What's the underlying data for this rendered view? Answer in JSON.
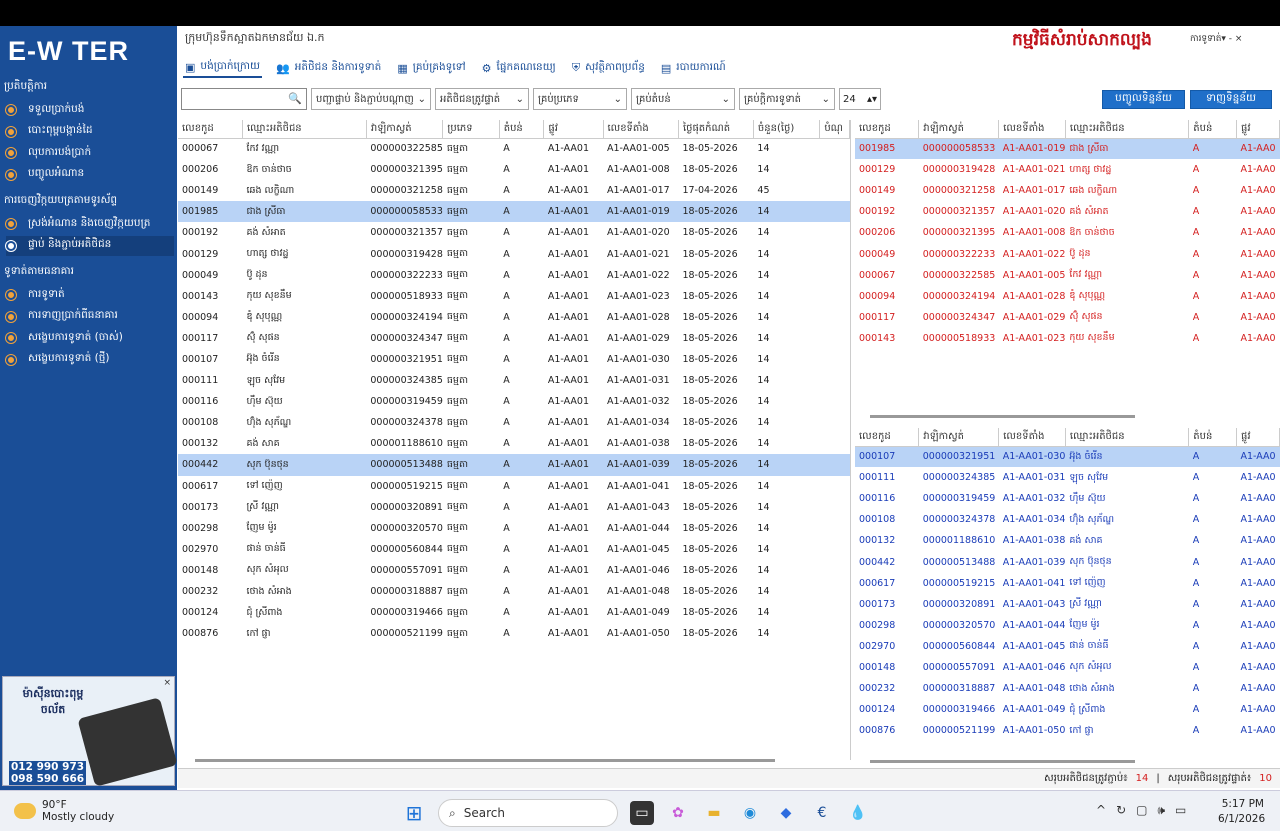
{
  "sidebar": {
    "logo": "E-W TER",
    "sections": [
      {
        "title": "ប្រតិបត្តិការ",
        "items": [
          "ទទួលប្រាក់បង់",
          "បោះពុម្ពបង្កាន់ដៃ",
          "លុបការបង់ប្រាក់",
          "បញ្ចូលអំណាន"
        ]
      },
      {
        "title": "ការចេញវិក្កយបត្រតាមទូរស័ព្ទ",
        "items": [
          "ស្រង់អំណាន និងចេញវិក្កយបត្រ",
          "ផ្ទាប់ និងភ្ជាប់អតិថិជន"
        ]
      },
      {
        "title": "ទូទាត់តាមធនាគារ",
        "items": [
          "ការទូទាត់",
          "ការទាញប្រាក់ពីធនាគារ",
          "សង្ខេបការទូទាត់ (ចាស់)",
          "សង្ខេបការទូទាត់ (ថ្មី)"
        ]
      }
    ],
    "ad": {
      "title": "ម៉ាស៊ីនបោះពុម្ពចល័ត",
      "phone1": "012 990 973",
      "phone2": "098 590 666",
      "close": "×"
    }
  },
  "header": {
    "company": "ក្រុមហ៊ុនទឹកស្អាតឯកមានជ័យ ឯ.ក",
    "title": "កម្មវិធីសំរាប់សាកល្បង",
    "user": "ការទូទាត់▾ - ×"
  },
  "tabs": [
    "បង់ប្រាក់ក្រោយ",
    "អតិថិជន និងការទូទាត់",
    "គ្រប់គ្រងទូទៅ",
    "ផ្នែកគណនេយ្យ",
    "សុវត្ថិភាពប្រព័ន្ធ",
    "របាយការណ៍"
  ],
  "tab_icons": [
    "book-icon",
    "users-icon",
    "grid-icon",
    "gear-icon",
    "shield-icon",
    "report-icon"
  ],
  "toolbar": {
    "search_value": "",
    "dropdowns": [
      "បញ្ជាផ្ទាប់ និងភ្ជាប់បណ្តាញ",
      "អតិថិជនត្រូវផ្ទាត់",
      "គ្រប់ប្រភេទ",
      "គ្រប់តំបន់",
      "គ្រប់ក្តិការទូទាត់"
    ],
    "number": "24",
    "btn1": "បញ្ចូលទិន្នន័យ",
    "btn2": "ទាញទិន្នន័យ"
  },
  "left_table": {
    "headers": [
      "លេខកូដ",
      "ឈ្មោះអតិថិជន",
      "វាឡិកាស្វត់",
      "ប្រភេទ",
      "តំបន់",
      "ផ្លូវ",
      "លេខទីតាំង",
      "ថ្ងៃផុតកំណត់",
      "ចំនួន(ថ្ងៃ)",
      "បំណុ"
    ],
    "rows": [
      [
        "000067",
        "កែវ វណ្ណា",
        "000000322585",
        "ធម្មតា",
        "A",
        "A1-AA01",
        "A1-AA01-005",
        "18-05-2026",
        "14",
        ""
      ],
      [
        "000206",
        "ឱក ចាន់ថាច",
        "000000321395",
        "ធម្មតា",
        "A",
        "A1-AA01",
        "A1-AA01-008",
        "18-05-2026",
        "14",
        ""
      ],
      [
        "000149",
        "ឆេង លក្ខិណា",
        "000000321258",
        "ធម្មតា",
        "A",
        "A1-AA01",
        "A1-AA01-017",
        "17-04-2026",
        "45",
        ""
      ],
      [
        "001985",
        "ជាង ស្រីធា",
        "000000058533",
        "ធម្មតា",
        "A",
        "A1-AA01",
        "A1-AA01-019",
        "18-05-2026",
        "14",
        ""
      ],
      [
        "000192",
        "គង់ សំអាត",
        "000000321357",
        "ធម្មតា",
        "A",
        "A1-AA01",
        "A1-AA01-020",
        "18-05-2026",
        "14",
        ""
      ],
      [
        "000129",
        "ហាត្ស ថាវដ្ឋ",
        "000000319428",
        "ធម្មតា",
        "A",
        "A1-AA01",
        "A1-AA01-021",
        "18-05-2026",
        "14",
        ""
      ],
      [
        "000049",
        "ប៊ូ ដុន",
        "000000322233",
        "ធម្មតា",
        "A",
        "A1-AA01",
        "A1-AA01-022",
        "18-05-2026",
        "14",
        ""
      ],
      [
        "000143",
        "កុយ សុខនឹម",
        "000000518933",
        "ធម្មតា",
        "A",
        "A1-AA01",
        "A1-AA01-023",
        "18-05-2026",
        "14",
        ""
      ],
      [
        "000094",
        "ឌុំ សុបុណ្ណ",
        "000000324194",
        "ធម្មតា",
        "A",
        "A1-AA01",
        "A1-AA01-028",
        "18-05-2026",
        "14",
        ""
      ],
      [
        "000117",
        "ស៊ុំ សុផន",
        "000000324347",
        "ធម្មតា",
        "A",
        "A1-AA01",
        "A1-AA01-029",
        "18-05-2026",
        "14",
        ""
      ],
      [
        "000107",
        "អ៊ុង ចំរើន",
        "000000321951",
        "ធម្មតា",
        "A",
        "A1-AA01",
        "A1-AA01-030",
        "18-05-2026",
        "14",
        ""
      ],
      [
        "000111",
        "ឡុច សុវែម",
        "000000324385",
        "ធម្មតា",
        "A",
        "A1-AA01",
        "A1-AA01-031",
        "18-05-2026",
        "14",
        ""
      ],
      [
        "000116",
        "ហ៊ឹម ស៊ុយ",
        "000000319459",
        "ធម្មតា",
        "A",
        "A1-AA01",
        "A1-AA01-032",
        "18-05-2026",
        "14",
        ""
      ],
      [
        "000108",
        "ហ៊ុំង សុភ័ណ្ឌ",
        "000000324378",
        "ធម្មតា",
        "A",
        "A1-AA01",
        "A1-AA01-034",
        "18-05-2026",
        "14",
        ""
      ],
      [
        "000132",
        "គង់ សាគ",
        "000001188610",
        "ធម្មតា",
        "A",
        "A1-AA01",
        "A1-AA01-038",
        "18-05-2026",
        "14",
        ""
      ],
      [
        "000442",
        "សុក ប៊ុនថុន",
        "000000513488",
        "ធម្មតា",
        "A",
        "A1-AA01",
        "A1-AA01-039",
        "18-05-2026",
        "14",
        ""
      ],
      [
        "000617",
        "ទៅ ញ៉េញ",
        "000000519215",
        "ធម្មតា",
        "A",
        "A1-AA01",
        "A1-AA01-041",
        "18-05-2026",
        "14",
        ""
      ],
      [
        "000173",
        "ស្រី វណ្ណា",
        "000000320891",
        "ធម្មតា",
        "A",
        "A1-AA01",
        "A1-AA01-043",
        "18-05-2026",
        "14",
        ""
      ],
      [
        "000298",
        "ញែម ម៉ូរ",
        "000000320570",
        "ធម្មតា",
        "A",
        "A1-AA01",
        "A1-AA01-044",
        "18-05-2026",
        "14",
        ""
      ],
      [
        "002970",
        "ផាន់ ចាន់ធី",
        "000000560844",
        "ធម្មតា",
        "A",
        "A1-AA01",
        "A1-AA01-045",
        "18-05-2026",
        "14",
        ""
      ],
      [
        "000148",
        "សុក សំអុល",
        "000000557091",
        "ធម្មតា",
        "A",
        "A1-AA01",
        "A1-AA01-046",
        "18-05-2026",
        "14",
        ""
      ],
      [
        "000232",
        "ថោង សំអាង",
        "000000318887",
        "ធម្មតា",
        "A",
        "A1-AA01",
        "A1-AA01-048",
        "18-05-2026",
        "14",
        ""
      ],
      [
        "000124",
        "ជុំ ស្រីពាង",
        "000000319466",
        "ធម្មតា",
        "A",
        "A1-AA01",
        "A1-AA01-049",
        "18-05-2026",
        "14",
        ""
      ],
      [
        "000876",
        "កៅ ផ្ញា",
        "000000521199",
        "ធម្មតា",
        "A",
        "A1-AA01",
        "A1-AA01-050",
        "18-05-2026",
        "14",
        ""
      ]
    ],
    "selected": [
      3,
      15
    ]
  },
  "right_top_table": {
    "headers": [
      "លេខកូដ",
      "វាឡិកាស្វត់",
      "លេខទីតាំង",
      "ឈ្មោះអតិថិជន",
      "តំបន់",
      "ផ្លូវ"
    ],
    "rows": [
      [
        "001985",
        "000000058533",
        "A1-AA01-019",
        "ជាង ស្រីធា",
        "A",
        "A1-AA0"
      ],
      [
        "000129",
        "000000319428",
        "A1-AA01-021",
        "ហាត្ស ថាវដ្ឋ",
        "A",
        "A1-AA0"
      ],
      [
        "000149",
        "000000321258",
        "A1-AA01-017",
        "ឆេង លក្ខិណា",
        "A",
        "A1-AA0"
      ],
      [
        "000192",
        "000000321357",
        "A1-AA01-020",
        "គង់ សំអាត",
        "A",
        "A1-AA0"
      ],
      [
        "000206",
        "000000321395",
        "A1-AA01-008",
        "ឱក ចាន់ថាច",
        "A",
        "A1-AA0"
      ],
      [
        "000049",
        "000000322233",
        "A1-AA01-022",
        "ប៊ូ ដុន",
        "A",
        "A1-AA0"
      ],
      [
        "000067",
        "000000322585",
        "A1-AA01-005",
        "កែវ វណ្ណា",
        "A",
        "A1-AA0"
      ],
      [
        "000094",
        "000000324194",
        "A1-AA01-028",
        "ឌុំ សុបុណ្ណ",
        "A",
        "A1-AA0"
      ],
      [
        "000117",
        "000000324347",
        "A1-AA01-029",
        "ស៊ុំ សុផន",
        "A",
        "A1-AA0"
      ],
      [
        "000143",
        "000000518933",
        "A1-AA01-023",
        "កុយ សុខនឹម",
        "A",
        "A1-AA0"
      ]
    ],
    "selected": [
      0
    ]
  },
  "right_bottom_table": {
    "headers": [
      "លេខកូដ",
      "វាឡិកាស្វត់",
      "លេខទីតាំង",
      "ឈ្មោះអតិថិជន",
      "តំបន់",
      "ផ្លូវ"
    ],
    "rows": [
      [
        "000107",
        "000000321951",
        "A1-AA01-030",
        "អ៊ុង ចំរើន",
        "A",
        "A1-AA0"
      ],
      [
        "000111",
        "000000324385",
        "A1-AA01-031",
        "ឡុច សុវែម",
        "A",
        "A1-AA0"
      ],
      [
        "000116",
        "000000319459",
        "A1-AA01-032",
        "ហ៊ឹម ស៊ុយ",
        "A",
        "A1-AA0"
      ],
      [
        "000108",
        "000000324378",
        "A1-AA01-034",
        "ហ៊ុំង សុភ័ណ្ឌ",
        "A",
        "A1-AA0"
      ],
      [
        "000132",
        "000001188610",
        "A1-AA01-038",
        "គង់ សាគ",
        "A",
        "A1-AA0"
      ],
      [
        "000442",
        "000000513488",
        "A1-AA01-039",
        "សុក ប៊ុនថុន",
        "A",
        "A1-AA0"
      ],
      [
        "000617",
        "000000519215",
        "A1-AA01-041",
        "ទៅ ញ៉េញ",
        "A",
        "A1-AA0"
      ],
      [
        "000173",
        "000000320891",
        "A1-AA01-043",
        "ស្រី វណ្ណា",
        "A",
        "A1-AA0"
      ],
      [
        "000298",
        "000000320570",
        "A1-AA01-044",
        "ញែម ម៉ូរ",
        "A",
        "A1-AA0"
      ],
      [
        "002970",
        "000000560844",
        "A1-AA01-045",
        "ផាន់ ចាន់ធី",
        "A",
        "A1-AA0"
      ],
      [
        "000148",
        "000000557091",
        "A1-AA01-046",
        "សុក សំអុល",
        "A",
        "A1-AA0"
      ],
      [
        "000232",
        "000000318887",
        "A1-AA01-048",
        "ថោង សំអាង",
        "A",
        "A1-AA0"
      ],
      [
        "000124",
        "000000319466",
        "A1-AA01-049",
        "ជុំ ស្រីពាង",
        "A",
        "A1-AA0"
      ],
      [
        "000876",
        "000000521199",
        "A1-AA01-050",
        "កៅ ផ្ញា",
        "A",
        "A1-AA0"
      ]
    ],
    "selected": [
      0
    ]
  },
  "status": {
    "label1": "សរុបអតិថិជនត្រូវភ្ជាប់៖",
    "value1": "14",
    "sep": "|",
    "label2": "សរុបអតិថិជនត្រូវផ្ទាត់៖",
    "value2": "10"
  },
  "taskbar": {
    "temp": "90°F",
    "weather": "Mostly cloudy",
    "search": "Search",
    "time": "5:17 PM",
    "date": "6/1/2026"
  },
  "colors": {
    "sidebar": "#1a4e97",
    "accent": "#1f6fc9",
    "red": "#d42020",
    "blue": "#1a3cb8",
    "select": "#b9d3f6"
  }
}
